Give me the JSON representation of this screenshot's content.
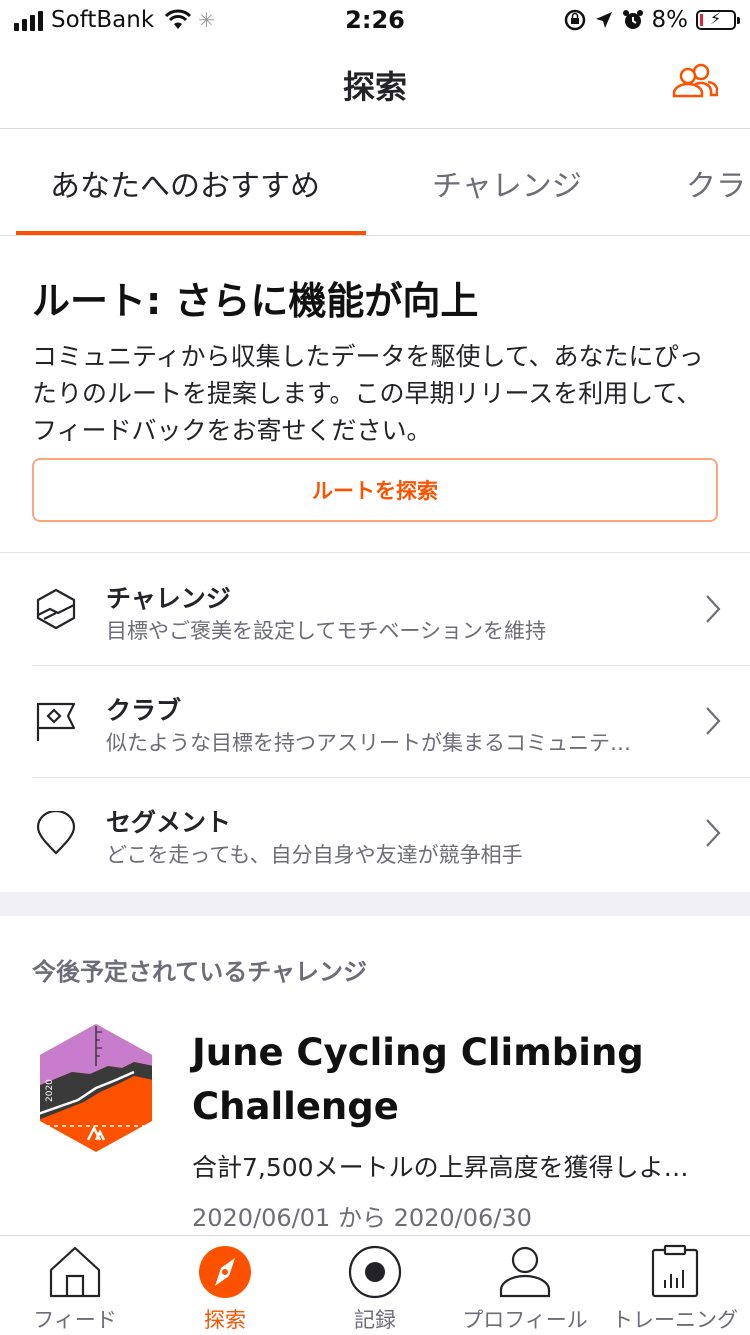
{
  "status_bar": {
    "carrier": "SoftBank",
    "time": "2:26",
    "battery": "8%"
  },
  "header": {
    "title": "探索",
    "right_icon": "people-icon"
  },
  "tabs": [
    {
      "label": "あなたへのおすすめ",
      "active": true
    },
    {
      "label": "チャレンジ",
      "active": false
    },
    {
      "label": "クラ",
      "active": false
    }
  ],
  "promo": {
    "title": "ルート: さらに機能が向上",
    "body": "コミュニティから収集したデータを駆使して、あなたにぴったりのルートを提案します。この早期リリースを利用して、フィードバックをお寄せください。",
    "button_label": "ルートを探索"
  },
  "list": [
    {
      "title": "チャレンジ",
      "subtitle": "目標やご褒美を設定してモチベーションを維持",
      "icon": "challenge-icon"
    },
    {
      "title": "クラブ",
      "subtitle": "似たような目標を持つアスリートが集まるコミュニテ…",
      "icon": "club-flag-icon"
    },
    {
      "title": "セグメント",
      "subtitle": "どこを走っても、自分自身や友達が競争相手",
      "icon": "segment-pin-icon"
    }
  ],
  "upcoming": {
    "section_title": "今後予定されているチャレンジ",
    "challenge": {
      "title": "June Cycling Climbing Challenge",
      "description": "合計7,500メートルの上昇高度を獲得しよ…",
      "dates": "2020/06/01 から 2020/06/30",
      "badge_year": "2020"
    }
  },
  "bottom_nav": [
    {
      "label": "フィード",
      "icon": "home-icon",
      "active": false
    },
    {
      "label": "探索",
      "icon": "explore-compass-icon",
      "active": true
    },
    {
      "label": "記録",
      "icon": "record-icon",
      "active": false
    },
    {
      "label": "プロフィール",
      "icon": "profile-icon",
      "active": false
    },
    {
      "label": "トレーニング",
      "icon": "training-calendar-icon",
      "active": false
    }
  ],
  "colors": {
    "accent": "#fc5200",
    "text_primary": "#242428",
    "text_secondary": "#6d6d78",
    "badge_purple": "#c77dcc",
    "badge_dark": "#3a3a3a"
  }
}
